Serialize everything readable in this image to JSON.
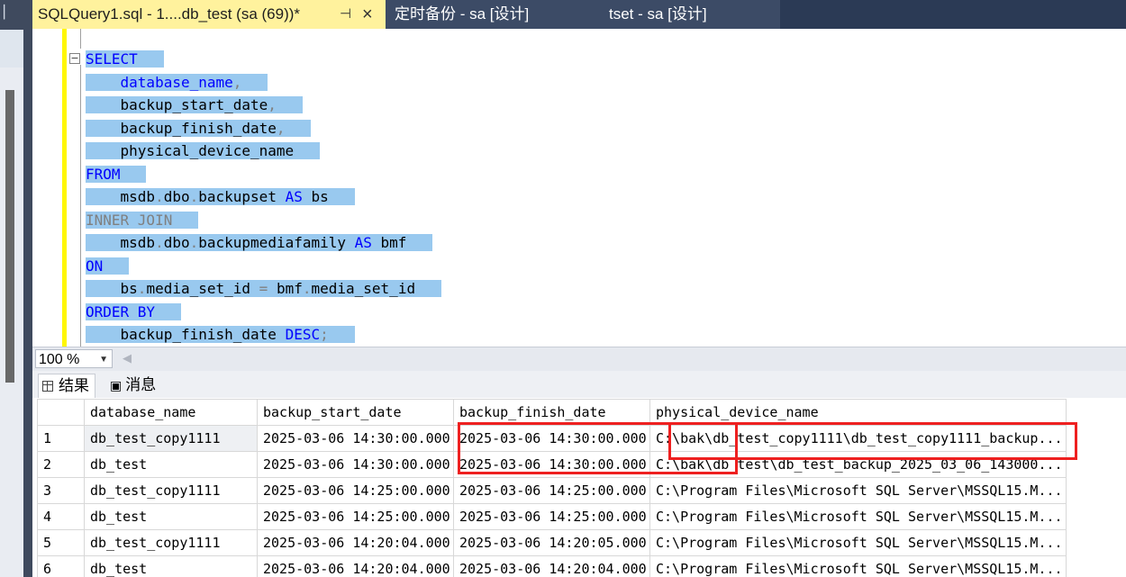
{
  "tabs": [
    {
      "label": "SQLQuery1.sql - 1....db_test (sa (69))*",
      "active": true
    },
    {
      "label": "定时备份 - sa [设计]",
      "active": false
    },
    {
      "label": "tset - sa [设计]",
      "active": false
    }
  ],
  "tab_pin_icon": "pin-icon",
  "tab_close_icon": "close-icon",
  "editor": {
    "fold_glyph": "−",
    "lines": [
      {
        "segs": [
          {
            "t": "SELECT",
            "c": "kw"
          }
        ]
      },
      {
        "segs": [
          {
            "t": "    database_name",
            "c": "kw"
          },
          {
            "t": ",",
            "c": "gr"
          }
        ]
      },
      {
        "segs": [
          {
            "t": "    backup_start_date",
            "c": "pl"
          },
          {
            "t": ",",
            "c": "gr"
          }
        ]
      },
      {
        "segs": [
          {
            "t": "    backup_finish_date",
            "c": "pl"
          },
          {
            "t": ",",
            "c": "gr"
          }
        ]
      },
      {
        "segs": [
          {
            "t": "    physical_device_name",
            "c": "pl"
          }
        ]
      },
      {
        "segs": [
          {
            "t": "FROM",
            "c": "kw"
          }
        ]
      },
      {
        "segs": [
          {
            "t": "    msdb",
            "c": "pl"
          },
          {
            "t": ".",
            "c": "gr"
          },
          {
            "t": "dbo",
            "c": "pl"
          },
          {
            "t": ".",
            "c": "gr"
          },
          {
            "t": "backupset ",
            "c": "pl"
          },
          {
            "t": "AS",
            "c": "kw"
          },
          {
            "t": " bs",
            "c": "pl"
          }
        ]
      },
      {
        "segs": [
          {
            "t": "INNER JOIN",
            "c": "kw-gray"
          }
        ]
      },
      {
        "segs": [
          {
            "t": "    msdb",
            "c": "pl"
          },
          {
            "t": ".",
            "c": "gr"
          },
          {
            "t": "dbo",
            "c": "pl"
          },
          {
            "t": ".",
            "c": "gr"
          },
          {
            "t": "backupmediafamily ",
            "c": "pl"
          },
          {
            "t": "AS",
            "c": "kw"
          },
          {
            "t": " bmf",
            "c": "pl"
          }
        ]
      },
      {
        "segs": [
          {
            "t": "ON",
            "c": "kw"
          }
        ]
      },
      {
        "segs": [
          {
            "t": "    bs",
            "c": "pl"
          },
          {
            "t": ".",
            "c": "gr"
          },
          {
            "t": "media_set_id ",
            "c": "pl"
          },
          {
            "t": "=",
            "c": "gr"
          },
          {
            "t": " bmf",
            "c": "pl"
          },
          {
            "t": ".",
            "c": "gr"
          },
          {
            "t": "media_set_id",
            "c": "pl"
          }
        ]
      },
      {
        "segs": [
          {
            "t": "ORDER BY",
            "c": "kw"
          }
        ]
      },
      {
        "segs": [
          {
            "t": "    backup_finish_date ",
            "c": "pl"
          },
          {
            "t": "DESC",
            "c": "kw"
          },
          {
            "t": ";",
            "c": "gr"
          }
        ]
      }
    ]
  },
  "zoom": {
    "value": "100 %"
  },
  "results_tabs": {
    "results": "结果",
    "messages": "消息"
  },
  "grid": {
    "columns": [
      "database_name",
      "backup_start_date",
      "backup_finish_date",
      "physical_device_name"
    ],
    "rows": [
      {
        "n": "1",
        "db": "db_test_copy1111",
        "start": "2025-03-06 14:30:00.000",
        "finish": "2025-03-06 14:30:00.000",
        "path": "C:\\bak\\db_test_copy1111\\db_test_copy1111_backup..."
      },
      {
        "n": "2",
        "db": "db_test",
        "start": "2025-03-06 14:30:00.000",
        "finish": "2025-03-06 14:30:00.000",
        "path": "C:\\bak\\db_test\\db_test_backup_2025_03_06_143000..."
      },
      {
        "n": "3",
        "db": "db_test_copy1111",
        "start": "2025-03-06 14:25:00.000",
        "finish": "2025-03-06 14:25:00.000",
        "path": "C:\\Program Files\\Microsoft SQL Server\\MSSQL15.M..."
      },
      {
        "n": "4",
        "db": "db_test",
        "start": "2025-03-06 14:25:00.000",
        "finish": "2025-03-06 14:25:00.000",
        "path": "C:\\Program Files\\Microsoft SQL Server\\MSSQL15.M..."
      },
      {
        "n": "5",
        "db": "db_test_copy1111",
        "start": "2025-03-06 14:20:04.000",
        "finish": "2025-03-06 14:20:05.000",
        "path": "C:\\Program Files\\Microsoft SQL Server\\MSSQL15.M..."
      },
      {
        "n": "6",
        "db": "db_test",
        "start": "2025-03-06 14:20:04.000",
        "finish": "2025-03-06 14:20:04.000",
        "path": "C:\\Program Files\\Microsoft SQL Server\\MSSQL15.M..."
      }
    ]
  },
  "colors": {
    "selection": "#99c9ef",
    "keyword": "#0000ff",
    "active_tab": "#fff29d",
    "highlight_box": "#ee2020"
  }
}
